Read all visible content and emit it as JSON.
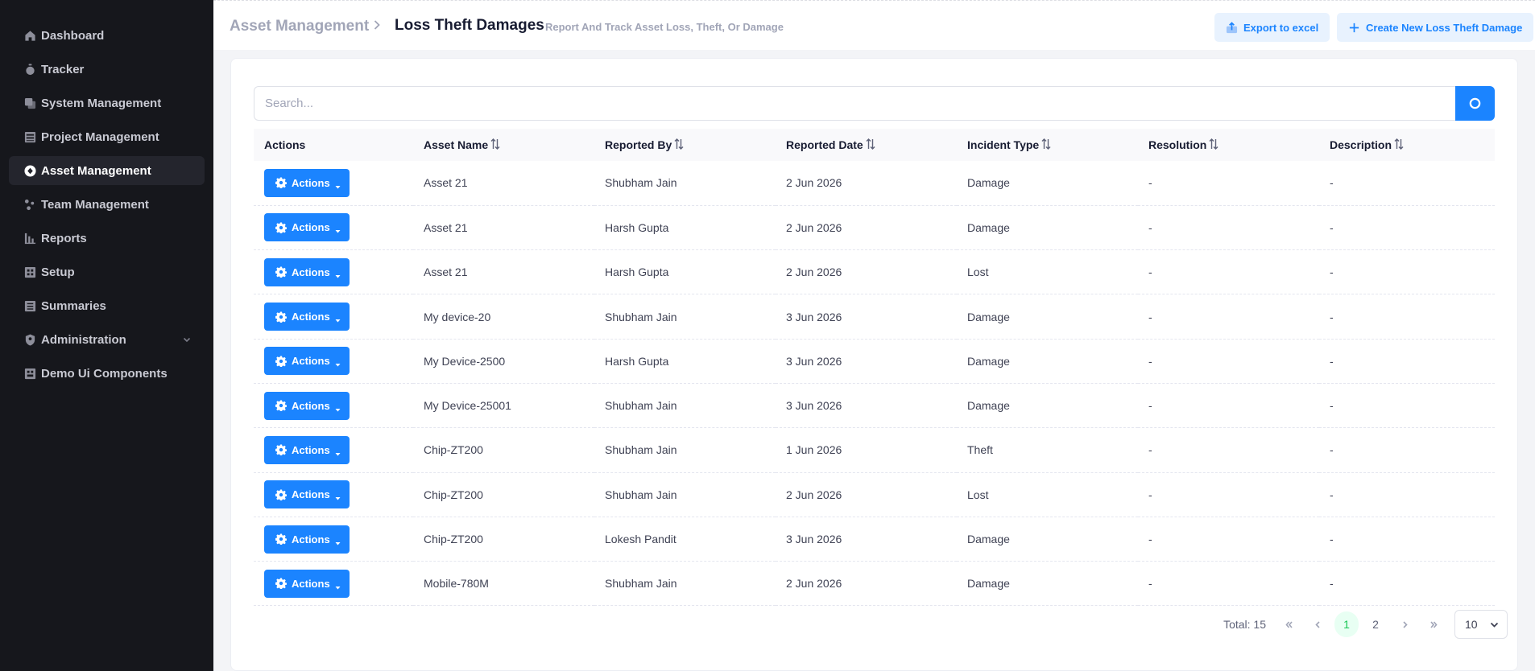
{
  "sidebar": {
    "items": [
      {
        "label": "Dashboard",
        "icon": "home-icon"
      },
      {
        "label": "Tracker",
        "icon": "stopwatch-icon"
      },
      {
        "label": "System Management",
        "icon": "layers-icon"
      },
      {
        "label": "Project Management",
        "icon": "grid-icon"
      },
      {
        "label": "Asset Management",
        "icon": "aperture-icon",
        "active": true
      },
      {
        "label": "Team Management",
        "icon": "people-icon"
      },
      {
        "label": "Reports",
        "icon": "chart-icon"
      },
      {
        "label": "Setup",
        "icon": "setup-icon"
      },
      {
        "label": "Summaries",
        "icon": "document-icon"
      },
      {
        "label": "Administration",
        "icon": "shield-icon",
        "has_children": true
      },
      {
        "label": "Demo Ui Components",
        "icon": "components-icon"
      }
    ]
  },
  "header": {
    "breadcrumb_root": "Asset Management",
    "title": "Loss Theft Damages",
    "subtitle": "Report And Track Asset Loss, Theft, Or Damage",
    "export_label": "Export to excel",
    "create_label": "Create New Loss Theft Damage"
  },
  "search": {
    "placeholder": "Search..."
  },
  "table": {
    "columns": [
      "Actions",
      "Asset Name",
      "Reported By",
      "Reported Date",
      "Incident Type",
      "Resolution",
      "Description"
    ],
    "action_label": "Actions",
    "rows": [
      {
        "asset": "Asset 21",
        "reported_by": "Shubham Jain",
        "date": "2 Jun 2026",
        "type": "Damage",
        "resolution": "-",
        "description": "-"
      },
      {
        "asset": "Asset 21",
        "reported_by": "Harsh Gupta",
        "date": "2 Jun 2026",
        "type": "Damage",
        "resolution": "-",
        "description": "-"
      },
      {
        "asset": "Asset 21",
        "reported_by": "Harsh Gupta",
        "date": "2 Jun 2026",
        "type": "Lost",
        "resolution": "-",
        "description": "-"
      },
      {
        "asset": "My device-20",
        "reported_by": "Shubham Jain",
        "date": "3 Jun 2026",
        "type": "Damage",
        "resolution": "-",
        "description": "-"
      },
      {
        "asset": "My Device-2500",
        "reported_by": "Harsh Gupta",
        "date": "3 Jun 2026",
        "type": "Damage",
        "resolution": "-",
        "description": "-"
      },
      {
        "asset": "My Device-25001",
        "reported_by": "Shubham Jain",
        "date": "3 Jun 2026",
        "type": "Damage",
        "resolution": "-",
        "description": "-"
      },
      {
        "asset": "Chip-ZT200",
        "reported_by": "Shubham Jain",
        "date": "1 Jun 2026",
        "type": "Theft",
        "resolution": "-",
        "description": "-"
      },
      {
        "asset": "Chip-ZT200",
        "reported_by": "Shubham Jain",
        "date": "2 Jun 2026",
        "type": "Lost",
        "resolution": "-",
        "description": "-"
      },
      {
        "asset": "Chip-ZT200",
        "reported_by": "Lokesh Pandit",
        "date": "3 Jun 2026",
        "type": "Damage",
        "resolution": "-",
        "description": "-"
      },
      {
        "asset": "Mobile-780M",
        "reported_by": "Shubham Jain",
        "date": "2 Jun 2026",
        "type": "Damage",
        "resolution": "-",
        "description": "-"
      }
    ]
  },
  "pagination": {
    "total_label": "Total: 15",
    "pages": [
      "1",
      "2"
    ],
    "current_page": "1",
    "page_size": "10"
  },
  "colors": {
    "accent": "#1b84ff",
    "sidebar_bg": "#16171c",
    "active_page_bg": "#e8fff3"
  }
}
